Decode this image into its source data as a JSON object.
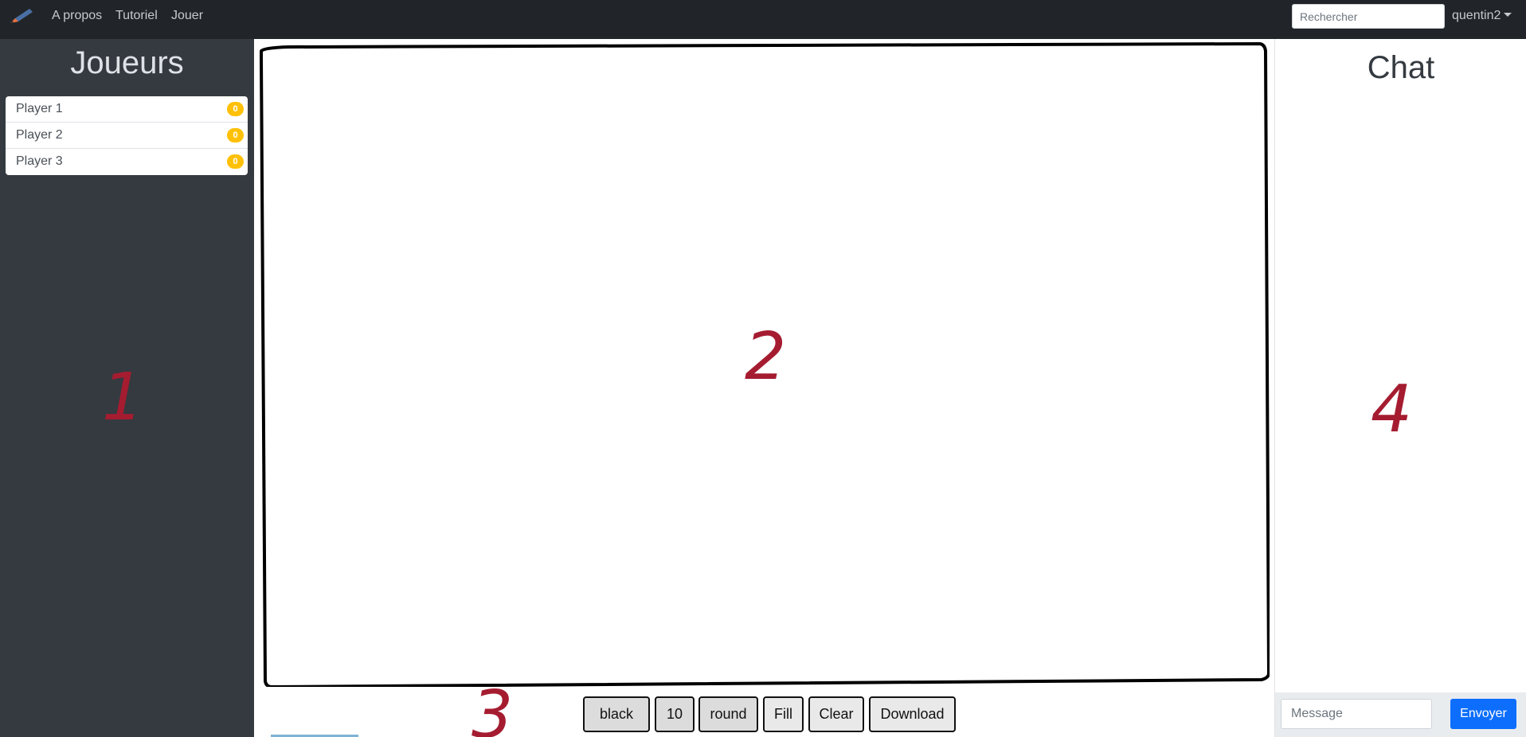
{
  "navbar": {
    "brand_icon": "pencil-icon",
    "links": [
      "A propos",
      "Tutoriel",
      "Jouer"
    ],
    "search_placeholder": "Rechercher",
    "user": "quentin2"
  },
  "sidebar": {
    "title": "Joueurs",
    "players": [
      {
        "name": "Player 1",
        "score": "0"
      },
      {
        "name": "Player 2",
        "score": "0"
      },
      {
        "name": "Player 3",
        "score": "0"
      }
    ]
  },
  "annotations": {
    "one": "1",
    "two": "2",
    "three": "3",
    "four": "4"
  },
  "toolbar": {
    "color": "black",
    "size": "10",
    "cap": "round",
    "fill": "Fill",
    "clear": "Clear",
    "download": "Download"
  },
  "chat": {
    "title": "Chat",
    "message_placeholder": "Message",
    "send_label": "Envoyer"
  },
  "colors": {
    "navbar": "#212529",
    "sidebar": "#343a40",
    "badge": "#ffc107",
    "annotation": "#a51c30",
    "send_button": "#0d6efd"
  }
}
